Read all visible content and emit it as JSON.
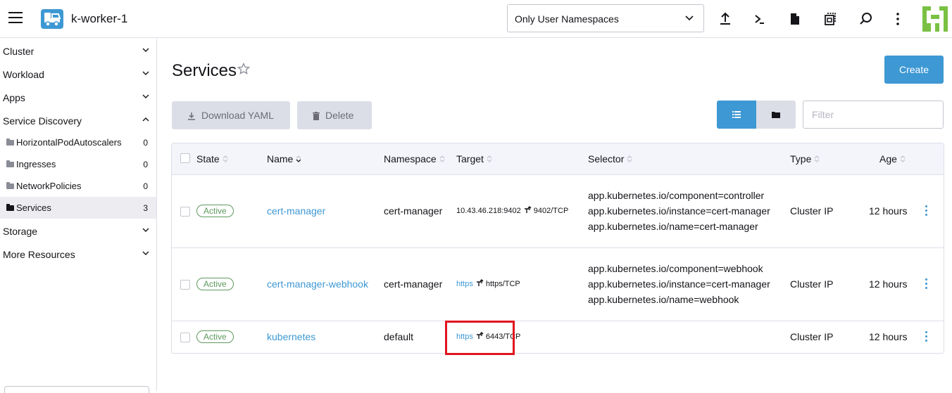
{
  "topbar": {
    "cluster_name": "k-worker-1",
    "namespace_select": "Only User Namespaces",
    "icons": [
      "import-yaml-icon",
      "kubectl-shell-icon",
      "kubeconfig-icon",
      "copy-kubeconfig-icon",
      "search-icon",
      "more-vertical-icon"
    ]
  },
  "sidebar": {
    "groups": [
      {
        "label": "Cluster"
      },
      {
        "label": "Workload"
      },
      {
        "label": "Apps"
      },
      {
        "label": "Service Discovery"
      }
    ],
    "items": [
      {
        "label": "HorizontalPodAutoscalers",
        "count": "0"
      },
      {
        "label": "Ingresses",
        "count": "0"
      },
      {
        "label": "NetworkPolicies",
        "count": "0"
      },
      {
        "label": "Services",
        "count": "3"
      }
    ],
    "groups_after": [
      {
        "label": "Storage"
      },
      {
        "label": "More Resources"
      }
    ]
  },
  "main": {
    "title": "Services",
    "create_label": "Create",
    "download_label": "Download YAML",
    "delete_label": "Delete",
    "filter_placeholder": "Filter"
  },
  "table": {
    "headers": {
      "state": "State",
      "name": "Name",
      "namespace": "Namespace",
      "target": "Target",
      "selector": "Selector",
      "type": "Type",
      "age": "Age"
    },
    "rows": [
      {
        "state": "Active",
        "name": "cert-manager",
        "namespace": "cert-manager",
        "target_from": "10.43.46.218:9402",
        "target_to": "9402/TCP",
        "selector": [
          "app.kubernetes.io/component=controller",
          "app.kubernetes.io/instance=cert-manager",
          "app.kubernetes.io/name=cert-manager"
        ],
        "type": "Cluster IP",
        "age": "12 hours"
      },
      {
        "state": "Active",
        "name": "cert-manager-webhook",
        "namespace": "cert-manager",
        "target_from": "https",
        "target_to": "https/TCP",
        "selector": [
          "app.kubernetes.io/component=webhook",
          "app.kubernetes.io/instance=cert-manager",
          "app.kubernetes.io/name=webhook"
        ],
        "type": "Cluster IP",
        "age": "12 hours"
      },
      {
        "state": "Active",
        "name": "kubernetes",
        "namespace": "default",
        "target_from": "https",
        "target_to": "6443/TCP",
        "selector": [],
        "type": "Cluster IP",
        "age": "12 hours"
      }
    ]
  },
  "colors": {
    "accent": "#3d98d3",
    "active_badge": "#5d995d",
    "highlight": "#e0141e"
  }
}
